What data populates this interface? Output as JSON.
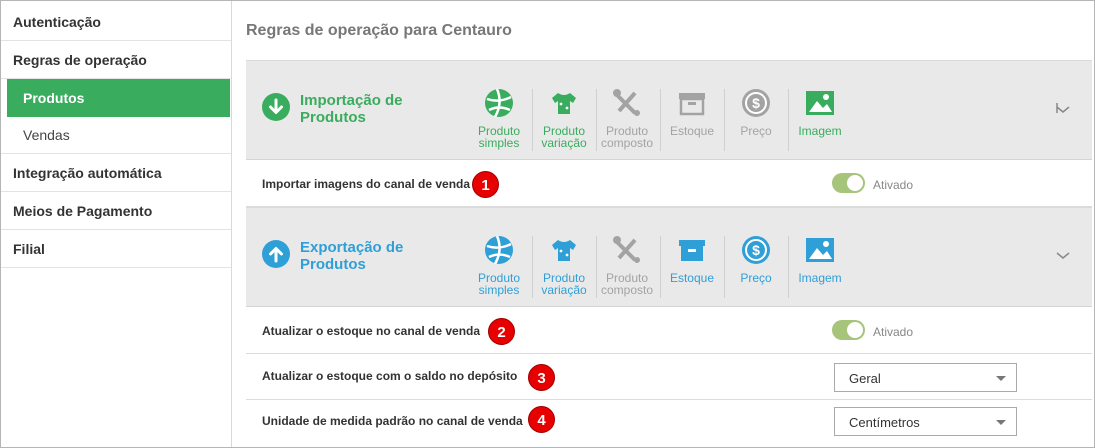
{
  "sidebar": {
    "items": [
      {
        "label": "Autenticação"
      },
      {
        "label": "Regras de operação"
      },
      {
        "label": "Produtos"
      },
      {
        "label": "Vendas"
      },
      {
        "label": "Integração automática"
      },
      {
        "label": "Meios de Pagamento"
      },
      {
        "label": "Filial"
      }
    ]
  },
  "page": {
    "title": "Regras de operação para Centauro"
  },
  "colors": {
    "import_accent": "#3aac5e",
    "export_accent": "#2f9fd8",
    "disabled": "#a3a3a3",
    "badge": "#e60000",
    "toggle_on": "#a6c47a"
  },
  "import_section": {
    "title_line1": "Importação de",
    "title_line2": "Produtos",
    "ops": [
      {
        "line1": "Produto",
        "line2": "simples",
        "icon": "ball-icon"
      },
      {
        "line1": "Produto",
        "line2": "variação",
        "icon": "shirt-icon"
      },
      {
        "line1": "Produto",
        "line2": "composto",
        "icon": "tools-icon"
      },
      {
        "line1": "Estoque",
        "line2": "",
        "icon": "box-icon"
      },
      {
        "line1": "Preço",
        "line2": "",
        "icon": "dollar-icon"
      },
      {
        "line1": "Imagem",
        "line2": "",
        "icon": "image-icon"
      }
    ],
    "rows": [
      {
        "label": "Importar imagens do canal de venda",
        "badge": "1",
        "toggle_text": "Ativado"
      }
    ]
  },
  "export_section": {
    "title_line1": "Exportação de",
    "title_line2": "Produtos",
    "ops": [
      {
        "line1": "Produto",
        "line2": "simples",
        "icon": "ball-icon"
      },
      {
        "line1": "Produto",
        "line2": "variação",
        "icon": "shirt-icon"
      },
      {
        "line1": "Produto",
        "line2": "composto",
        "icon": "tools-icon"
      },
      {
        "line1": "Estoque",
        "line2": "",
        "icon": "box-icon"
      },
      {
        "line1": "Preço",
        "line2": "",
        "icon": "dollar-icon"
      },
      {
        "line1": "Imagem",
        "line2": "",
        "icon": "image-icon"
      }
    ],
    "rows": [
      {
        "label": "Atualizar o estoque no canal de venda",
        "badge": "2",
        "toggle_text": "Ativado"
      },
      {
        "label": "Atualizar o estoque com o saldo no depósito",
        "badge": "3",
        "select_value": "Geral"
      },
      {
        "label": "Unidade de medida padrão no canal de venda",
        "badge": "4",
        "select_value": "Centímetros"
      }
    ]
  }
}
